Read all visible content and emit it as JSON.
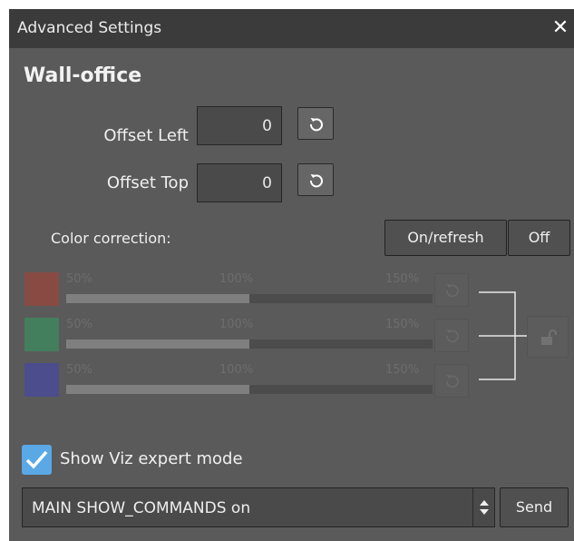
{
  "window": {
    "title": "Advanced Settings",
    "close_icon": "close-icon"
  },
  "section": {
    "title": "Wall-office"
  },
  "offsets": {
    "left": {
      "label": "Offset Left",
      "value": "0",
      "reset_icon": "reset-icon"
    },
    "top": {
      "label": "Offset Top",
      "value": "0",
      "reset_icon": "reset-icon"
    }
  },
  "color_correction": {
    "label": "Color correction:",
    "on_refresh_label": "On/refresh",
    "off_label": "Off",
    "enabled": false,
    "channels": [
      {
        "name": "red",
        "swatch_color": "#c0392b",
        "min_label": "50%",
        "mid_label": "100%",
        "max_label": "150%",
        "value_fraction": 0.5
      },
      {
        "name": "green",
        "swatch_color": "#27ae60",
        "min_label": "50%",
        "mid_label": "100%",
        "max_label": "150%",
        "value_fraction": 0.5
      },
      {
        "name": "blue",
        "swatch_color": "#3b3fc9",
        "min_label": "50%",
        "mid_label": "100%",
        "max_label": "150%",
        "value_fraction": 0.5
      }
    ],
    "lock_icon": "unlock-icon"
  },
  "expert_mode": {
    "label": "Show Viz expert mode",
    "checked": true
  },
  "command": {
    "value": "MAIN SHOW_COMMANDS on",
    "send_label": "Send"
  },
  "colors": {
    "panel_bg": "#5a5a5a",
    "titlebar_bg": "#3b3b3b",
    "accent_checkbox": "#5aa9e6"
  }
}
